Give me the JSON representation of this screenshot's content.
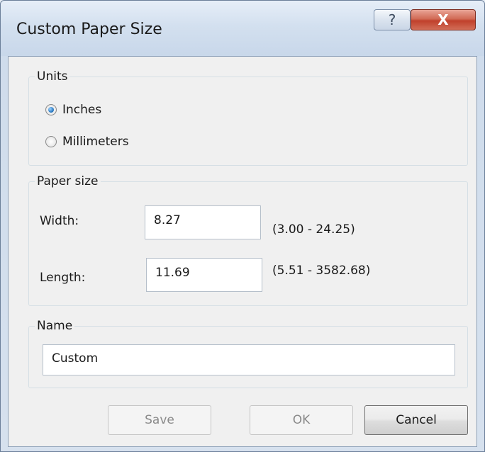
{
  "window": {
    "title": "Custom Paper Size",
    "help_glyph": "?",
    "close_glyph": "X"
  },
  "units": {
    "legend": "Units",
    "options": [
      {
        "label": "Inches",
        "checked": true
      },
      {
        "label": "Millimeters",
        "checked": false
      }
    ]
  },
  "paper_size": {
    "legend": "Paper size",
    "width": {
      "label": "Width:",
      "value": "8.27",
      "range": "(3.00 - 24.25)"
    },
    "length": {
      "label": "Length:",
      "value": "11.69",
      "range": "(5.51 - 3582.68)"
    }
  },
  "name": {
    "legend": "Name",
    "value": "Custom"
  },
  "buttons": {
    "save": "Save",
    "ok": "OK",
    "cancel": "Cancel"
  },
  "colors": {
    "close_button": "#c0402b",
    "radio_checked": "#2f7dc4"
  }
}
